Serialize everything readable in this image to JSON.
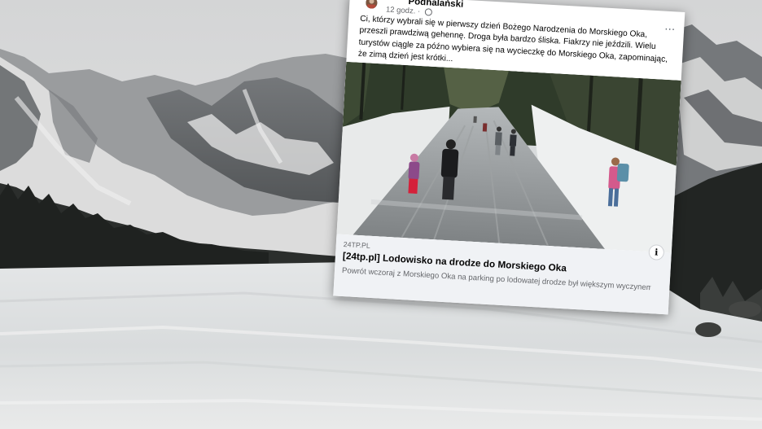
{
  "post": {
    "author": "Podhalański",
    "time": "12 godz.",
    "separator": "·",
    "more_icon": "⋯",
    "text": "Ci, którzy wybrali się w pierwszy dzień Bożego Narodzenia do Morskiego Oka, przeszli prawdziwą gehennę. Droga była bardzo śliska. Fiakrzy nie jeździli. Wielu turystów ciągle za późno wybiera się na wycieczkę do Morskiego Oka, zapominając, że zimą dzień jest krótki..."
  },
  "link": {
    "domain": "24TP.PL",
    "title": "[24tp.pl] Lodowisko na drodze do Morskiego Oka",
    "description": "Powrót wczoraj z Morskiego Oka na parking po lodowatej drodze był większym wyczynem niż ...",
    "info_icon": "i"
  },
  "colors": {
    "card_bg": "#ffffff",
    "link_bg": "#f0f2f5",
    "text": "#050505",
    "muted": "#65676b"
  }
}
